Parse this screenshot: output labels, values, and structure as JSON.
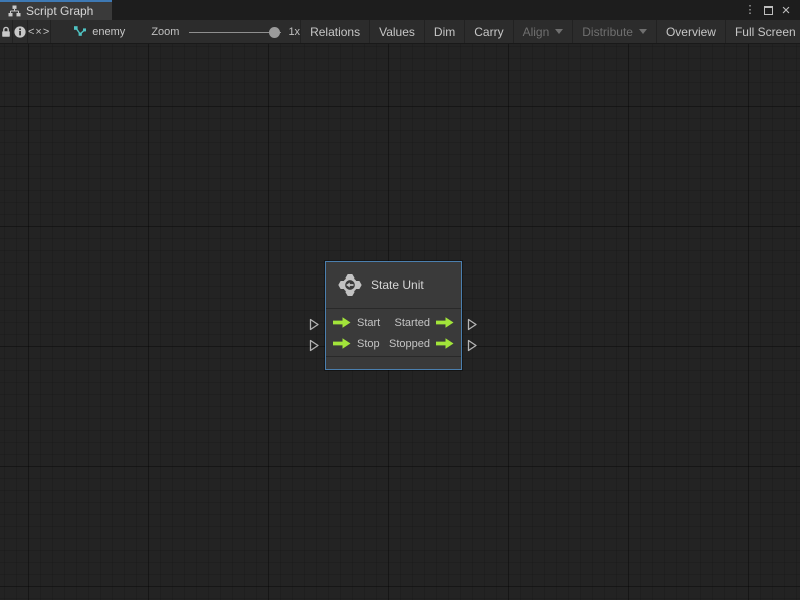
{
  "window": {
    "tab": {
      "label": "Script Graph",
      "active": true
    },
    "controls": [
      {
        "name": "more-menu-icon"
      },
      {
        "name": "maximize-icon"
      },
      {
        "name": "close-icon"
      }
    ]
  },
  "toolbar": {
    "left_icons": [
      "lock-icon",
      "info-icon",
      "code-toggle-icon"
    ],
    "code_toggle": "<×>",
    "graph_name": "enemy",
    "zoom": {
      "label": "Zoom",
      "value": "1x"
    },
    "buttons": [
      {
        "label": "Relations",
        "enabled": true,
        "dropdown": false
      },
      {
        "label": "Values",
        "enabled": true,
        "dropdown": false
      },
      {
        "label": "Dim",
        "enabled": true,
        "dropdown": false
      },
      {
        "label": "Carry",
        "enabled": true,
        "dropdown": false
      },
      {
        "label": "Align",
        "enabled": false,
        "dropdown": true
      },
      {
        "label": "Distribute",
        "enabled": false,
        "dropdown": true
      },
      {
        "label": "Overview",
        "enabled": true,
        "dropdown": false
      },
      {
        "label": "Full Screen",
        "enabled": true,
        "dropdown": false
      }
    ]
  },
  "graph": {
    "node": {
      "title": "State Unit",
      "icon": "state-unit-icon",
      "rows": [
        {
          "input": "Start",
          "output": "Started"
        },
        {
          "input": "Stop",
          "output": "Stopped"
        }
      ]
    }
  },
  "colors": {
    "tab_accent_blue": "#3e79b4",
    "node_border_selected": "#4b7fae",
    "port_arrow_green": "#a2e43a",
    "graph_icon_teal": "#4fc3c3",
    "canvas_background": "#232323",
    "toolbar_background": "#2c2c2c"
  }
}
